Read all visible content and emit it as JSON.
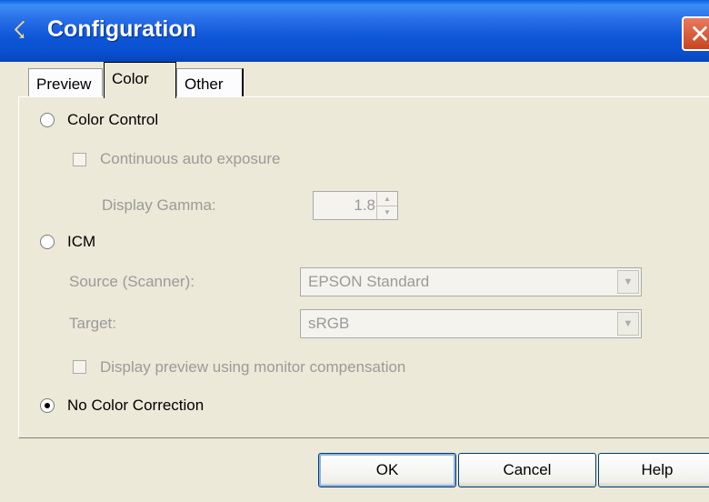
{
  "window": {
    "title": "Configuration",
    "app_icon": "scanner-app-icon",
    "close_glyph": "✕"
  },
  "tabs": [
    {
      "label": "Preview",
      "selected": false
    },
    {
      "label": "Color",
      "selected": true
    },
    {
      "label": "Other",
      "selected": false
    }
  ],
  "color_control": {
    "label": "Color Control",
    "selected": false,
    "continuous_auto_exposure": {
      "label": "Continuous auto exposure",
      "checked": false,
      "enabled": false
    },
    "display_gamma": {
      "label": "Display Gamma:",
      "value": "1.8",
      "enabled": false
    }
  },
  "icm": {
    "label": "ICM",
    "selected": false,
    "source": {
      "label": "Source (Scanner):",
      "value": "EPSON Standard",
      "enabled": false
    },
    "target": {
      "label": "Target:",
      "value": "sRGB",
      "enabled": false
    },
    "monitor_compensation": {
      "label": "Display preview using monitor compensation",
      "checked": false,
      "enabled": false
    }
  },
  "no_color_correction": {
    "label": "No Color Correction",
    "selected": true
  },
  "buttons": {
    "ok": "OK",
    "cancel": "Cancel",
    "help": "Help"
  },
  "colors": {
    "titlebar": "#0a56d8",
    "dialog_bg": "#ece9d8",
    "disabled_text": "#9a9a9a"
  }
}
